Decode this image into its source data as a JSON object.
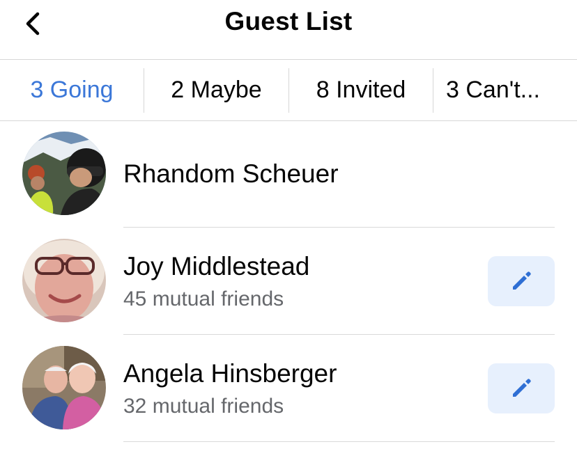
{
  "header": {
    "title": "Guest List",
    "back_icon": "chevron-left-icon"
  },
  "tabs": [
    {
      "label": "3 Going",
      "active": true
    },
    {
      "label": "2 Maybe",
      "active": false
    },
    {
      "label": "8 Invited",
      "active": false
    },
    {
      "label": "3 Can't...",
      "active": false
    }
  ],
  "guests": [
    {
      "name": "Rhandom Scheuer",
      "mutual": "",
      "editable": false
    },
    {
      "name": "Joy Middlestead",
      "mutual": "45 mutual friends",
      "editable": true
    },
    {
      "name": "Angela Hinsberger",
      "mutual": "32 mutual friends",
      "editable": true
    }
  ],
  "colors": {
    "accent": "#3b77d8",
    "edit_button_bg": "#e7f0fd",
    "secondary_text": "#65676b"
  },
  "icons": {
    "edit": "pencil-icon"
  }
}
